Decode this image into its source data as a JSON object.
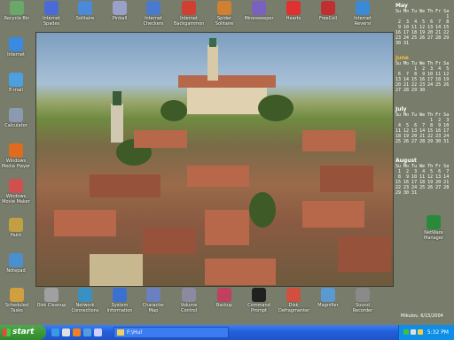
{
  "desktop": {
    "top_icons": [
      {
        "label": "Recycle Bin",
        "icon": "recycle-bin-icon",
        "color": "#6aa86a"
      },
      {
        "label": "Internet Spades",
        "icon": "spades-icon",
        "color": "#4a6ad8"
      },
      {
        "label": "Solitaire",
        "icon": "solitaire-icon",
        "color": "#4a8ad8"
      },
      {
        "label": "Pinball",
        "icon": "pinball-icon",
        "color": "#9aa0c8"
      },
      {
        "label": "Internet Checkers",
        "icon": "checkers-icon",
        "color": "#4a7ad0"
      },
      {
        "label": "Internet Backgammon",
        "icon": "backgammon-icon",
        "color": "#d04030"
      },
      {
        "label": "Spider Solitaire",
        "icon": "spider-solitaire-icon",
        "color": "#d08030"
      },
      {
        "label": "Minesweeper",
        "icon": "minesweeper-icon",
        "color": "#7a60c0"
      },
      {
        "label": "Hearts",
        "icon": "hearts-icon",
        "color": "#e03030"
      },
      {
        "label": "FreeCell",
        "icon": "freecell-icon",
        "color": "#c03030"
      },
      {
        "label": "Internet Reversi",
        "icon": "reversi-icon",
        "color": "#3a8ad8"
      }
    ],
    "left_icons": [
      {
        "label": "Internet",
        "icon": "internet-explorer-icon",
        "color": "#3a8ae0"
      },
      {
        "label": "E-mail",
        "icon": "email-icon",
        "color": "#4aa0e0"
      },
      {
        "label": "Calculator",
        "icon": "calculator-icon",
        "color": "#8a9ab0"
      },
      {
        "label": "Windows Media Player",
        "icon": "media-player-icon",
        "color": "#e06a20"
      },
      {
        "label": "Windows Movie Maker",
        "icon": "movie-maker-icon",
        "color": "#d05050"
      },
      {
        "label": "Paint",
        "icon": "paint-icon",
        "color": "#c0a040"
      },
      {
        "label": "Notepad",
        "icon": "notepad-icon",
        "color": "#4a90d0"
      }
    ],
    "bottom_icons": [
      {
        "label": "Scheduled Tasks",
        "icon": "scheduled-tasks-icon",
        "color": "#d0a040"
      },
      {
        "label": "Disk Cleanup",
        "icon": "disk-cleanup-icon",
        "color": "#a0a0a0"
      },
      {
        "label": "Network Connections",
        "icon": "network-connections-icon",
        "color": "#3a90c0"
      },
      {
        "label": "System Information",
        "icon": "system-information-icon",
        "color": "#3a70d0"
      },
      {
        "label": "Character Map",
        "icon": "character-map-icon",
        "color": "#6a80c0"
      },
      {
        "label": "Volume Control",
        "icon": "volume-control-icon",
        "color": "#8a8aa0"
      },
      {
        "label": "Backup",
        "icon": "backup-icon",
        "color": "#c04060"
      },
      {
        "label": "Command Prompt",
        "icon": "command-prompt-icon",
        "color": "#202020"
      },
      {
        "label": "Disk Defragmenter",
        "icon": "disk-defragmenter-icon",
        "color": "#d05040"
      },
      {
        "label": "Magnifier",
        "icon": "magnifier-icon",
        "color": "#5a9ad0"
      },
      {
        "label": "Sound Recorder",
        "icon": "sound-recorder-icon",
        "color": "#8a8a8a"
      }
    ],
    "right_icon": {
      "label": "NetWare Manager",
      "icon": "netware-manager-icon",
      "color": "#2a8a3a"
    }
  },
  "calendar": {
    "months": [
      {
        "name": "May",
        "current": false,
        "rows": [
          "Su Mo Tu We Th Fr Sa",
          "                   1",
          " 2  3  4  5  6  7  8",
          " 9 10 11 12 13 14 15",
          "16 17 18 19 20 21 22",
          "23 24 25 26 27 28 29",
          "30 31"
        ]
      },
      {
        "name": "June",
        "current": true,
        "rows": [
          "Su Mo Tu We Th Fr Sa",
          "       1  2  3  4  5",
          " 6  7  8  9 10 11 12",
          "13 14 15 16 17 18 19",
          "20 21 22 23 24 25 26",
          "27 28 29 30"
        ]
      },
      {
        "name": "July",
        "current": false,
        "rows": [
          "Su Mo Tu We Th Fr Sa",
          "             1  2  3",
          " 4  5  6  7  8  9 10",
          "11 12 13 14 15 16 17",
          "18 19 20 21 22 23 24",
          "25 26 27 28 29 30 31"
        ]
      },
      {
        "name": "August",
        "current": false,
        "rows": [
          "Su Mo Tu We Th Fr Sa",
          " 1  2  3  4  5  6  7",
          " 8  9 10 11 12 13 14",
          "15 16 17 18 19 20 21",
          "22 23 24 25 26 27 28",
          "29 30 31"
        ]
      }
    ]
  },
  "wallpaper_caption": "Mikulov, 6/15/2004",
  "taskbar": {
    "start_label": "start",
    "task_label": "F:\\Hul",
    "clock": "5:32 PM"
  },
  "colors": {
    "desktop": "#787c6a",
    "taskbar": "#245edb",
    "start": "#2f8a2c",
    "tray": "#0f8ee8",
    "current_month": "#f0c040"
  }
}
